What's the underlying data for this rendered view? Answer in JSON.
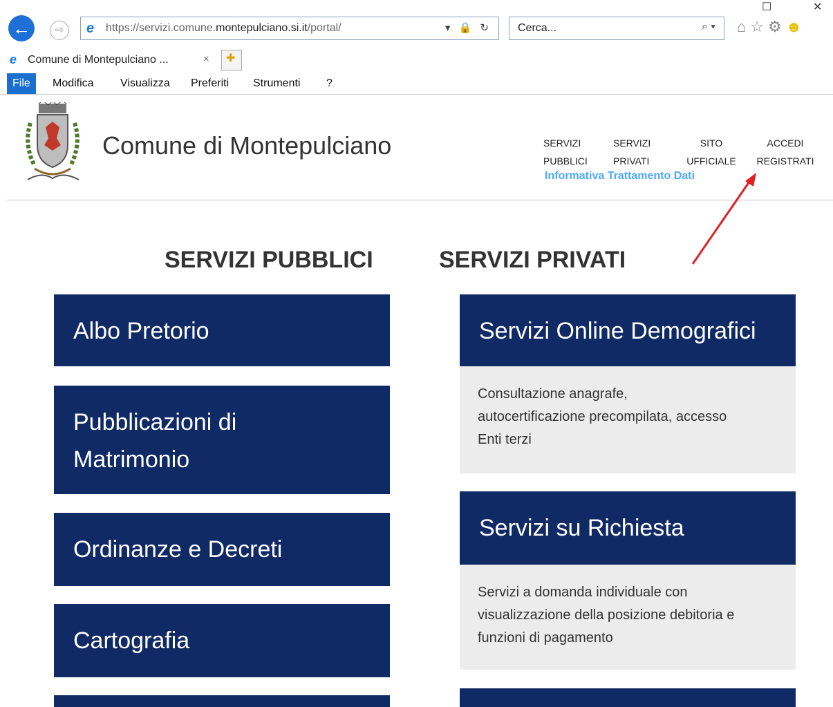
{
  "browser": {
    "window_controls": [
      "☐",
      "✕"
    ],
    "address": {
      "url_prefix": "https://servizi.comune.",
      "url_domain": "montepulciano.si.it",
      "url_path": "/portal/",
      "tools": "▾ 🔒 ↻"
    },
    "search": {
      "placeholder": "Cerca...",
      "icon": "search-icon"
    },
    "tab": {
      "title": "Comune di Montepulciano ...",
      "close": "×"
    },
    "menu": {
      "file": "File",
      "modifica": "Modifica",
      "visualizza": "Visualizza",
      "preferiti": "Preferiti",
      "strumenti": "Strumenti",
      "help": "?"
    }
  },
  "header": {
    "site_title": "Comune di Montepulciano",
    "nav": [
      {
        "line1": "SERVIZI",
        "line2": "PUBBLICI"
      },
      {
        "line1": "SERVIZI",
        "line2": "PRIVATI"
      },
      {
        "line1": "SITO",
        "line2": "UFFICIALE"
      },
      {
        "line1": "ACCEDI",
        "line2": "REGISTRATI"
      }
    ],
    "informativa": "Informativa Trattamento Dati"
  },
  "public_services": {
    "heading": "SERVIZI PUBBLICI",
    "items": [
      "Albo Pretorio",
      "Pubblicazioni di",
      "Matrimonio",
      "Ordinanze e Decreti",
      "Cartografia"
    ]
  },
  "private_services": {
    "heading": "SERVIZI PRIVATI",
    "items": [
      {
        "title": "Servizi Online Demografici",
        "desc1": "Consultazione anagrafe,",
        "desc2": "autocertificazione precompilata, accesso",
        "desc3": "Enti terzi"
      },
      {
        "title": "Servizi su Richiesta",
        "desc1": "Servizi a domanda individuale con",
        "desc2": "visualizzazione della posizione debitoria e",
        "desc3": "funzioni di pagamento"
      }
    ]
  },
  "colors": {
    "tile_bg": "#0f2a64",
    "desc_bg": "#ececec",
    "link_blue": "#4aa8ff",
    "arrow_red": "#e02020"
  }
}
